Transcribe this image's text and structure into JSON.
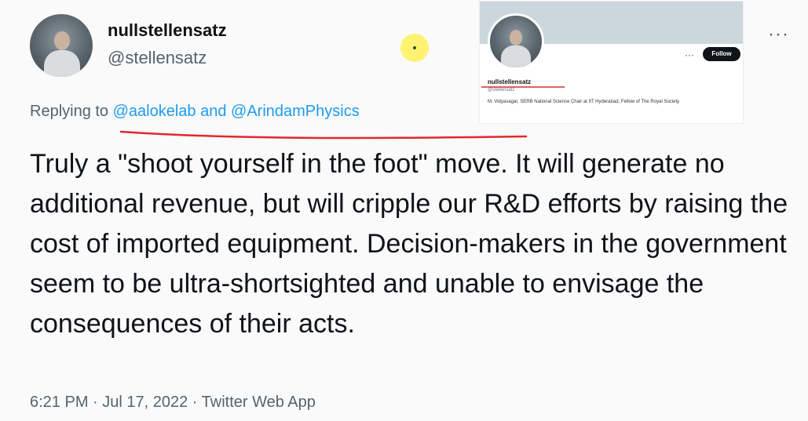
{
  "author": {
    "display_name": "nullstellensatz",
    "handle": "@stellensatz"
  },
  "reply": {
    "prefix": "Replying to ",
    "mentions": "@aalokelab and @ArindamPhysics"
  },
  "tweet": {
    "text": "Truly a \"shoot yourself in the foot\" move. It will generate no additional revenue, but will cripple our R&D efforts by raising the cost of imported equipment. Decision-makers in the government seem to be ultra-shortsighted and unable to envisage the consequences of their acts."
  },
  "meta": {
    "time_line": "6:21 PM · Jul 17, 2022 · Twitter Web App"
  },
  "more_menu": "···",
  "inset_profile": {
    "display_name": "nullstellensatz",
    "handle": "@stellensatz",
    "bio": "M. Vidyasagar, SERB National Science Chair at IIT Hyderabad, Fellow of The Royal Society",
    "follow_label": "Follow",
    "more": "···"
  },
  "colors": {
    "link": "#1d9bf0",
    "annotation": "#e0282e",
    "highlight": "#fff36a"
  },
  "icons": [
    "more-horizontal-icon"
  ]
}
